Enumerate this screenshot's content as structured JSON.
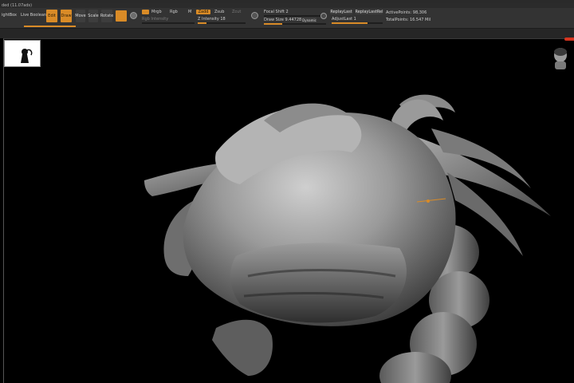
{
  "app": {
    "title": "ded (11.07ads)"
  },
  "toolbar": {
    "lightbox": "ightBox",
    "live_boolean": "Live Boolean",
    "edit": "Edit",
    "draw": "Draw",
    "move": "Move",
    "scale": "Scale",
    "rotate": "Rotate",
    "mrgb": "Mrgb",
    "rgb": "Rgb",
    "m": "M",
    "zadd": "Zadd",
    "zsub": "Zsub",
    "zcut": "Zcut",
    "rgb_intensity": "Rgb Intensity",
    "z_intensity": "Z Intensity 18",
    "focal_shift": "Focal Shift 2",
    "draw_size": "Draw Size 9.44728",
    "dynamic": "Dynamic",
    "replay_last": "ReplayLast",
    "replay_last_rel": "ReplayLastRel",
    "adjust_last": "AdjustLast 1",
    "active_points": "ActivePoints: 98,306",
    "total_points": "TotalPoints: 16.547 Mil",
    "z_intensity_value": 0.18,
    "draw_size_value": 0.3
  },
  "colors": {
    "accent": "#d98b27",
    "toolbar_bg": "#333333",
    "viewport_bg": "#000000",
    "marker": "#d6341f"
  }
}
